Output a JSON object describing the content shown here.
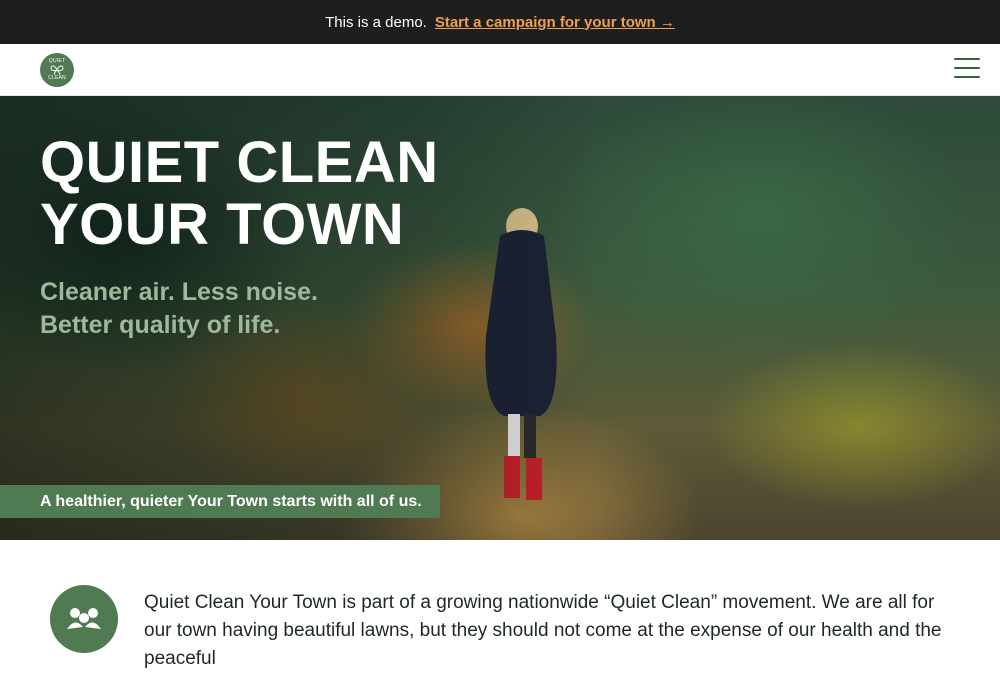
{
  "demo_bar": {
    "text": "This is a demo.",
    "cta": "Start a campaign for your town →"
  },
  "header": {
    "logo": {
      "line1": "QUIET",
      "line2": "CLEAN",
      "icon": "butterfly-icon"
    },
    "menu_icon": "hamburger-menu-icon"
  },
  "hero": {
    "title_line1": "QUIET CLEAN",
    "title_line2": "YOUR TOWN",
    "subtitle_line1": "Cleaner air. Less noise.",
    "subtitle_line2": "Better quality of life.",
    "tagline": "A healthier, quieter Your Town starts with all of us."
  },
  "intro": {
    "icon": "community-people-icon",
    "text": "Quiet Clean Your Town is part of a growing nationwide “Quiet Clean” movement. We are all for our town having beautiful lawns, but they should not come at the expense of our health and the peaceful"
  },
  "colors": {
    "brand_green": "#4f7a52",
    "demo_bar_bg": "#1e1e1e",
    "cta_orange": "#f0a04b",
    "subtitle_green": "#9db89b"
  }
}
